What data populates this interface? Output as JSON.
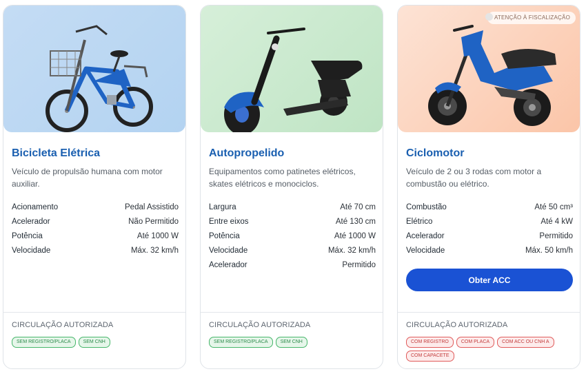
{
  "cards": [
    {
      "title": "Bicicleta Elétrica",
      "description": "Veículo de propulsão humana com motor auxiliar.",
      "image_icon": "electric-bicycle-icon",
      "specs": [
        {
          "label": "Acionamento",
          "value": "Pedal Assistido"
        },
        {
          "label": "Acelerador",
          "value": "Não Permitido"
        },
        {
          "label": "Potência",
          "value": "Até 1000 W"
        },
        {
          "label": "Velocidade",
          "value": "Máx. 32 km/h"
        }
      ],
      "circulation_label": "CIRCULAÇÃO AUTORIZADA",
      "tags": [
        {
          "text": "SEM REGISTRO/PLACA",
          "status": "ok"
        },
        {
          "text": "SEM CNH",
          "status": "ok"
        }
      ]
    },
    {
      "title": "Autopropelido",
      "description": "Equipamentos como patinetes elétricos, skates elétricos e monociclos.",
      "image_icon": "electric-scooter-icon",
      "specs": [
        {
          "label": "Largura",
          "value": "Até 70 cm"
        },
        {
          "label": "Entre eixos",
          "value": "Até 130 cm"
        },
        {
          "label": "Potência",
          "value": "Até 1000 W"
        },
        {
          "label": "Velocidade",
          "value": "Máx. 32 km/h"
        },
        {
          "label": "Acelerador",
          "value": "Permitido"
        }
      ],
      "circulation_label": "CIRCULAÇÃO AUTORIZADA",
      "tags": [
        {
          "text": "SEM REGISTRO/PLACA",
          "status": "ok"
        },
        {
          "text": "SEM CNH",
          "status": "ok"
        }
      ]
    },
    {
      "title": "Ciclomotor",
      "description": "Veículo de 2 ou 3 rodas com motor a combustão ou elétrico.",
      "image_icon": "moped-icon",
      "badge": "ATENÇÃO À FISCALIZAÇÃO",
      "specs": [
        {
          "label": "Combustão",
          "value": "Até 50 cm³"
        },
        {
          "label": "Elétrico",
          "value": "Até 4 kW"
        },
        {
          "label": "Acelerador",
          "value": "Permitido"
        },
        {
          "label": "Velocidade",
          "value": "Máx. 50 km/h"
        }
      ],
      "cta_label": "Obter ACC",
      "circulation_label": "CIRCULAÇÃO AUTORIZADA",
      "tags": [
        {
          "text": "COM REGISTRO",
          "status": "bad"
        },
        {
          "text": "COM PLACA",
          "status": "bad"
        },
        {
          "text": "COM ACC OU CNH A",
          "status": "bad"
        },
        {
          "text": "COM CAPACETE",
          "status": "bad"
        }
      ]
    }
  ],
  "colors": {
    "title": "#1a5fb0",
    "cta": "#1a52d4",
    "tag_ok": "#46b66a",
    "tag_bad": "#e05a5a",
    "vehicle_blue": "#1f63c4"
  }
}
